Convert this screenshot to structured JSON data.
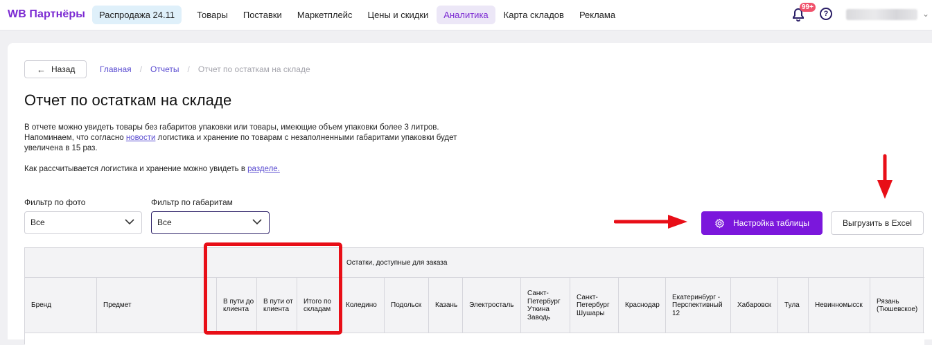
{
  "app": {
    "logo": "WB Партнёры"
  },
  "nav": {
    "promo": "Распродажа 24.11",
    "items": [
      "Товары",
      "Поставки",
      "Маркетплейс",
      "Цены и скидки",
      "Аналитика",
      "Карта складов",
      "Реклама"
    ],
    "active": "Аналитика"
  },
  "header": {
    "notifications_badge": "99+",
    "help_glyph": "?"
  },
  "page": {
    "back_label": "Назад",
    "breadcrumbs": [
      "Главная",
      "Отчеты",
      "Отчет по остаткам на складе"
    ],
    "title": "Отчет по остаткам на складе",
    "desc_line1": "В отчете можно увидеть товары без габаритов упаковки или товары, имеющие объем упаковки более 3 литров.",
    "desc_line2_pre": "Напоминаем, что согласно ",
    "desc_line2_link": "новости",
    "desc_line2_post": " логистика и хранение по товарам с незаполненными габаритами упаковки будет увеличена в 15 раз.",
    "desc_line3_pre": "Как рассчитывается логистика и хранение можно увидеть в ",
    "desc_line3_link": "разделе."
  },
  "filters": {
    "photo": {
      "label": "Фильтр по фото",
      "value": "Все"
    },
    "dims": {
      "label": "Фильтр по габаритам",
      "value": "Все"
    }
  },
  "actions": {
    "settings": "Настройка таблицы",
    "excel": "Выгрузить в Excel"
  },
  "table": {
    "group_header": "Остатки, доступные для заказа",
    "columns": [
      "Бренд",
      "Предмет",
      "В пути до клиента",
      "В пути от клиента",
      "Итого по складам",
      "Коледино",
      "Подольск",
      "Казань",
      "Электросталь",
      "Санкт-Петербург Уткина Заводь",
      "Санкт-Петербург Шушары",
      "Краснодар",
      "Екатеринбург - Перспективный 12",
      "Хабаровск",
      "Тула",
      "Невинномысск",
      "Рязань (Тюшевское)"
    ]
  },
  "colors": {
    "accent": "#7b17dc",
    "annotation": "#e80e17",
    "link": "#5b4dd1"
  }
}
